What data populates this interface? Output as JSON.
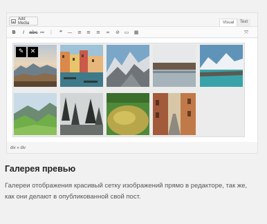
{
  "editor": {
    "add_media_label": "Add Media",
    "tabs": {
      "visual": "Visual",
      "text": "Text"
    },
    "toolbar_icons": [
      "bold-icon",
      "italic-icon",
      "strikethrough-icon",
      "bullet-list-icon",
      "numbered-list-icon",
      "blockquote-icon",
      "horizontal-rule-icon",
      "align-left-icon",
      "align-center-icon",
      "align-right-icon",
      "link-icon",
      "unlink-icon",
      "read-more-icon",
      "toolbar-toggle-icon",
      "fullscreen-icon"
    ],
    "path": "div » div"
  },
  "gallery": {
    "images": [
      "sunset-mountains",
      "venice-canal",
      "snowy-mountains",
      "lake-reeds",
      "glacier-lake",
      "green-valley",
      "misty-pines",
      "mossy-rock",
      "narrow-street"
    ],
    "edit_glyph": "✎",
    "remove_glyph": "✕"
  },
  "feature": {
    "title": "Галерея превью",
    "description": "Галереи отображения красивый сетку изображений прямо в редакторе, так же, как они делают в опубликованной свой пост."
  }
}
